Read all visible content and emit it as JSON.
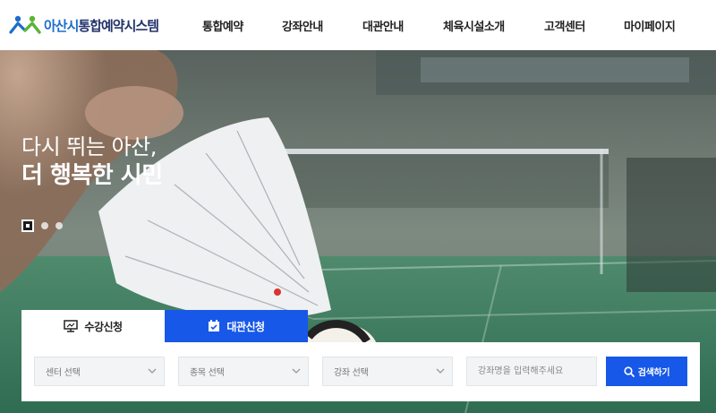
{
  "header": {
    "logo": {
      "text_city": "아산시",
      "text_system": "통합예약시스템"
    },
    "nav": [
      {
        "label": "통합예약"
      },
      {
        "label": "강좌안내"
      },
      {
        "label": "대관안내"
      },
      {
        "label": "체육시설소개"
      },
      {
        "label": "고객센터"
      },
      {
        "label": "마이페이지"
      }
    ]
  },
  "hero": {
    "title_line1": "다시 뛰는 아산,",
    "title_line2": "더 행복한 시민",
    "slides": {
      "count": 3,
      "active": 1
    }
  },
  "search": {
    "tabs": [
      {
        "label": "수강신청",
        "icon": "monitor-icon",
        "active": false
      },
      {
        "label": "대관신청",
        "icon": "calendar-check-icon",
        "active": true
      }
    ],
    "selects": [
      {
        "value": "센터 선택"
      },
      {
        "value": "종목 선택"
      },
      {
        "value": "강좌 선택"
      }
    ],
    "keyword": {
      "placeholder": "강좌명을 입력해주세요",
      "value": ""
    },
    "button_label": "검색하기"
  },
  "colors": {
    "accent": "#1758e8",
    "logo_blue": "#1c6ec9",
    "logo_navy": "#23346b",
    "logo_green": "#5cb531"
  }
}
